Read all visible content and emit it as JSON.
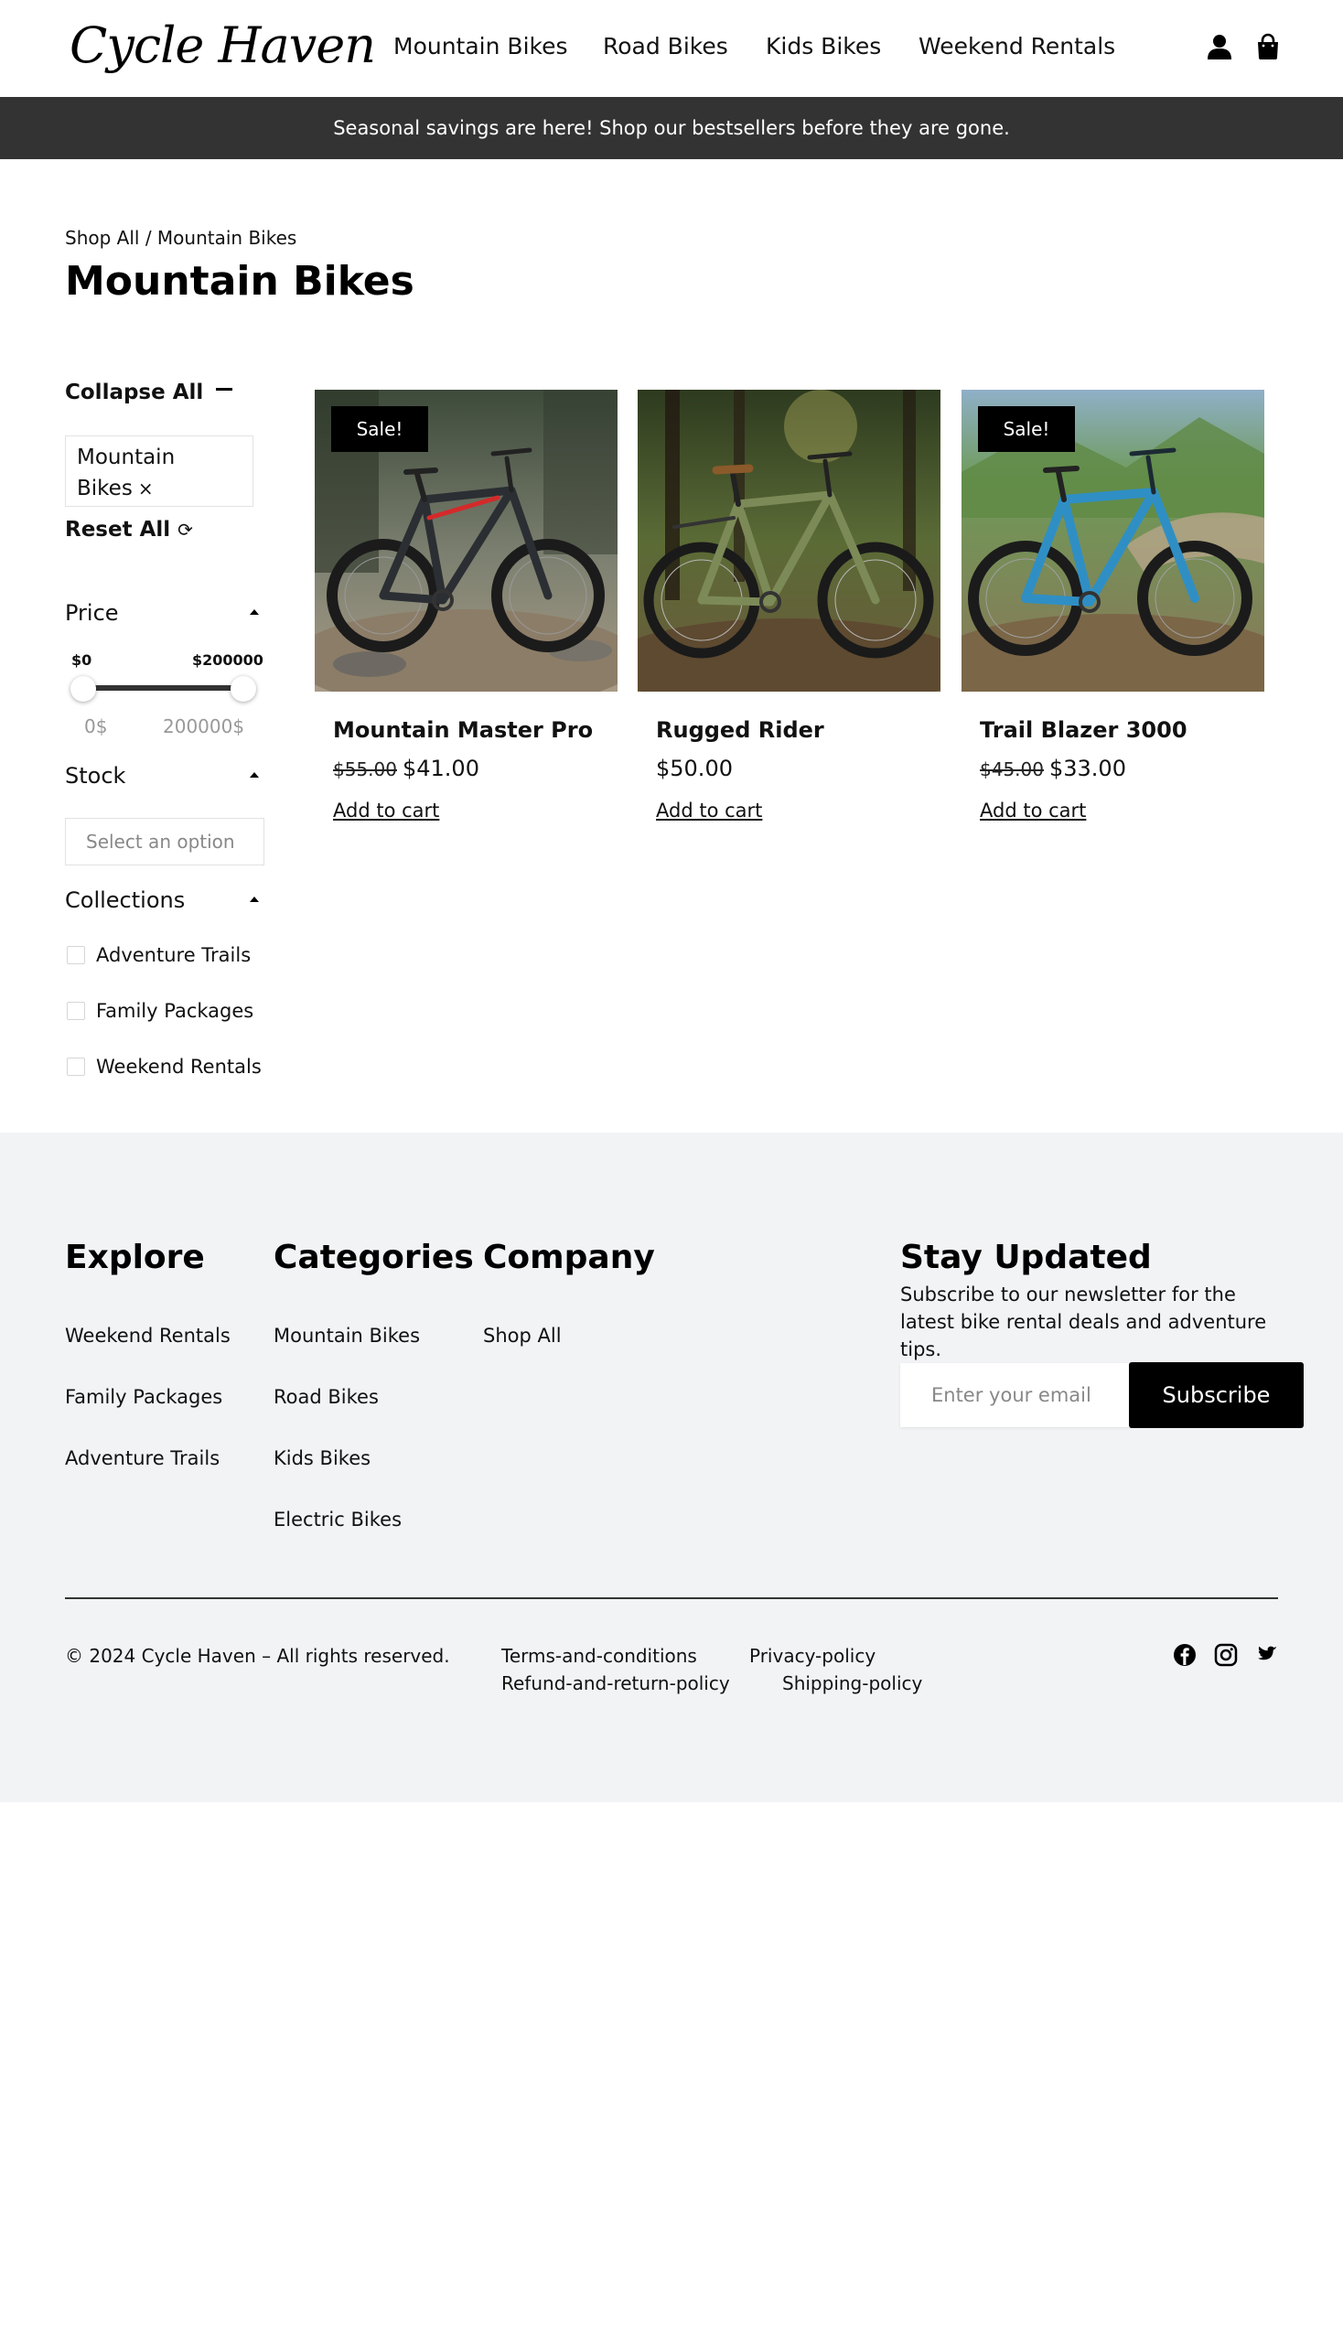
{
  "header": {
    "logo": "Cycle Haven",
    "nav": [
      "Mountain Bikes",
      "Road Bikes",
      "Kids Bikes",
      "Weekend Rentals"
    ],
    "icons": [
      "user-icon",
      "shopping-bag-icon"
    ]
  },
  "banner": {
    "text": "Seasonal savings are here! Shop our bestsellers before they are gone."
  },
  "breadcrumb": {
    "root": "Shop All",
    "separator": " / ",
    "current": "Mountain Bikes"
  },
  "page_title": "Mountain Bikes",
  "filters": {
    "collapse_all": "Collapse All",
    "active_chip": "Mountain Bikes",
    "chip_remove": "×",
    "reset_all": "Reset All",
    "price": {
      "label": "Price",
      "min_label": "$0",
      "max_label": "$200000",
      "min_value": "0$",
      "max_value": "200000$"
    },
    "stock": {
      "label": "Stock",
      "placeholder": "Select an option"
    },
    "collections": {
      "label": "Collections",
      "options": [
        "Adventure Trails",
        "Family Packages",
        "Weekend Rentals"
      ]
    }
  },
  "products": [
    {
      "name": "Mountain Master Pro",
      "badge": "Sale!",
      "old_price": "$55.00",
      "price": "$41.00",
      "cta": "Add to cart",
      "frame_color": "#2b2f33",
      "accent_color": "#d42a2a",
      "image": "mountain-bike-photo"
    },
    {
      "name": "Rugged Rider",
      "badge": "",
      "old_price": "",
      "price": "$50.00",
      "cta": "Add to cart",
      "frame_color": "#7c8a57",
      "accent_color": "#8b5a2b",
      "image": "mountain-bike-photo"
    },
    {
      "name": "Trail Blazer 3000",
      "badge": "Sale!",
      "old_price": "$45.00",
      "price": "$33.00",
      "cta": "Add to cart",
      "frame_color": "#2f8fc4",
      "accent_color": "#1c2a33",
      "image": "mountain-bike-photo"
    }
  ],
  "footer": {
    "explore": {
      "title": "Explore",
      "links": [
        "Weekend Rentals",
        "Family Packages",
        "Adventure Trails"
      ]
    },
    "categories": {
      "title": "Categories",
      "links": [
        "Mountain Bikes",
        "Road Bikes",
        "Kids Bikes",
        "Electric Bikes"
      ]
    },
    "company": {
      "title": "Company",
      "links": [
        "Shop All"
      ]
    },
    "newsletter": {
      "title": "Stay Updated",
      "text": "Subscribe to our newsletter for the latest bike rental deals and adventure tips.",
      "placeholder": "Enter your email",
      "button": "Subscribe"
    },
    "copyright": "© 2024 Cycle Haven – All rights reserved.",
    "legal": [
      "Terms-and-conditions",
      "Privacy-policy",
      "Refund-and-return-policy",
      "Shipping-policy"
    ],
    "social": [
      "facebook-icon",
      "instagram-icon",
      "twitter-icon"
    ]
  },
  "colors": {
    "banner_bg": "#333333",
    "footer_bg": "#f2f3f5",
    "sale_badge": "#000000",
    "subscribe_button": "#000000"
  }
}
